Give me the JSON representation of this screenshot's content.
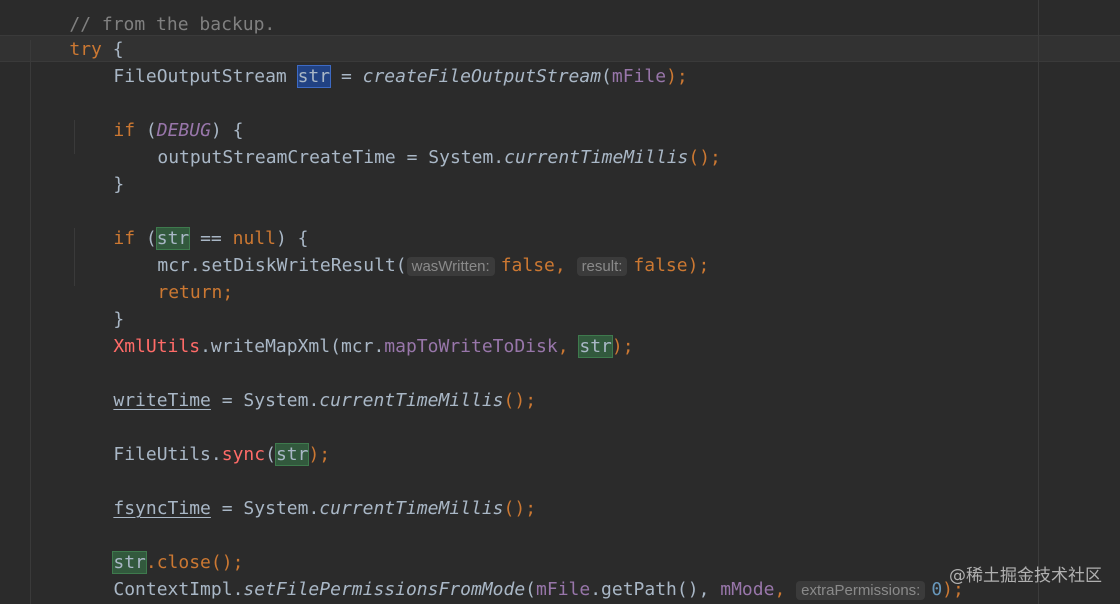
{
  "editor": {
    "theme": "darcula",
    "colors": {
      "background": "#2b2b2b",
      "keyword": "#cc7832",
      "text": "#a9b7c6",
      "field": "#9876aa",
      "error_highlight": "#ff6b68",
      "number": "#6897bb",
      "selection_blue": "#214283",
      "selection_green": "#32593d"
    },
    "lines": {
      "l0": {
        "comment": "// from the backup."
      },
      "l1": {
        "kw": "try",
        "rest": " {"
      },
      "l2": {
        "type": "FileOutputStream ",
        "var": "str",
        "eq": " = ",
        "call": "createFileOutputStream",
        "open": "(",
        "arg": "mFile",
        "close": ");"
      },
      "l4": {
        "kw": "if",
        "open": " (",
        "flag": "DEBUG",
        "close": ") {"
      },
      "l5": {
        "lhs": "outputStreamCreateTime = System.",
        "call": "currentTimeMillis",
        "end": "();"
      },
      "l6": {
        "text": "}"
      },
      "l8": {
        "kw": "if",
        "open": " (",
        "var": "str",
        "mid": " == ",
        "null": "null",
        "close": ") {"
      },
      "l9": {
        "pre": "mcr.setDiskWriteResult(",
        "hint1": "wasWritten:",
        "val1": "false",
        "comma": ", ",
        "hint2": "result:",
        "val2": "false",
        "end": ");"
      },
      "l10": {
        "kw": "return",
        "end": ";"
      },
      "l11": {
        "text": "}"
      },
      "l12": {
        "cls": "XmlUtils",
        "mid": ".writeMapXml(mcr.",
        "field": "mapToWriteToDisk",
        "comma": ", ",
        "var": "str",
        "end": ");"
      },
      "l14": {
        "lhs": "writeTime",
        "eq": " = System.",
        "call": "currentTimeMillis",
        "end": "();"
      },
      "l16": {
        "pre": "FileUtils.",
        "call": "sync",
        "open": "(",
        "var": "str",
        "end": ");"
      },
      "l18": {
        "lhs": "fsyncTime",
        "eq": " = System.",
        "call": "currentTimeMillis",
        "end": "();"
      },
      "l20": {
        "var": "str",
        "end": ".close();"
      },
      "l21": {
        "pre": "ContextImpl.",
        "call": "setFilePermissionsFromMode",
        "open": "(",
        "arg1": "mFile",
        "mid": ".getPath(), ",
        "arg2": "mMode",
        "comma": ", ",
        "hint": "extraPermissions:",
        "num": "0",
        "end": ");"
      }
    }
  },
  "watermark": "@稀土掘金技术社区"
}
